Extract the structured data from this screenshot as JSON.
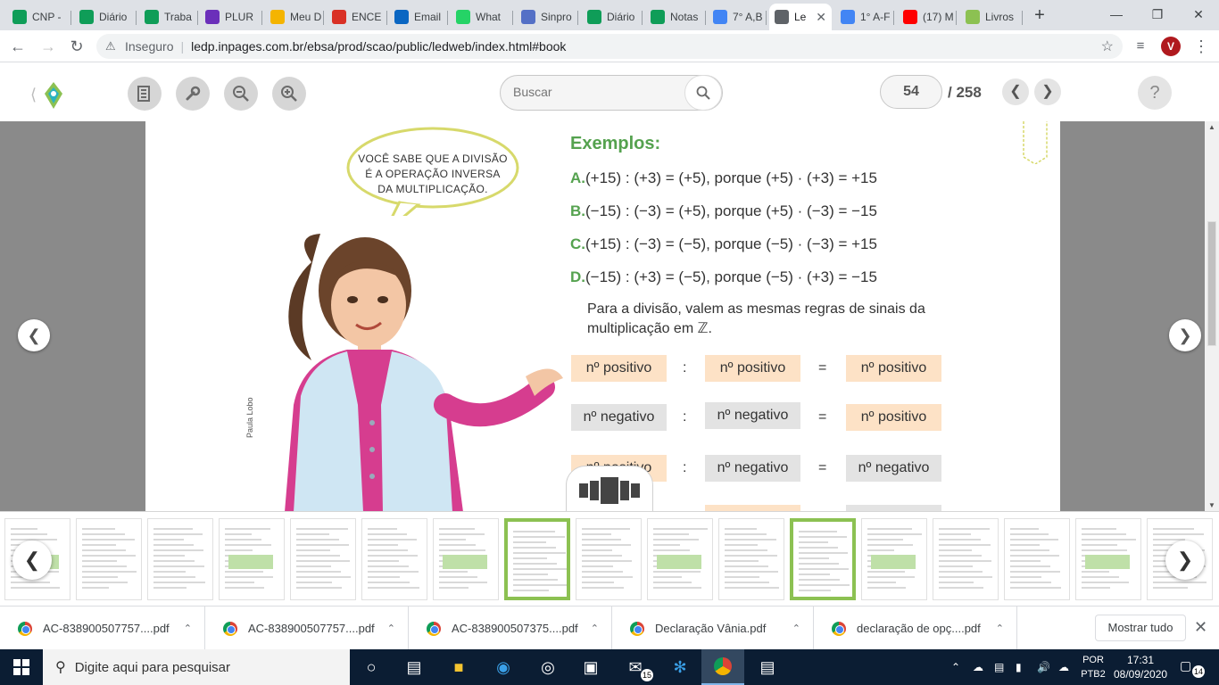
{
  "browser": {
    "tabs": [
      {
        "label": "CNP -",
        "color": "#0f9d58"
      },
      {
        "label": "Diário",
        "color": "#0f9d58"
      },
      {
        "label": "Traba",
        "color": "#0f9d58"
      },
      {
        "label": "PLUR",
        "color": "#6b2fba"
      },
      {
        "label": "Meu D",
        "color": "#f4b400"
      },
      {
        "label": "ENCE",
        "color": "#d93025"
      },
      {
        "label": "Email",
        "color": "#0a66c2"
      },
      {
        "label": "What",
        "color": "#25d366"
      },
      {
        "label": "Sinpro",
        "color": "#5470c6"
      },
      {
        "label": "Diário",
        "color": "#0f9d58"
      },
      {
        "label": "Notas",
        "color": "#0f9d58"
      },
      {
        "label": "7° A,B",
        "color": "#4285f4"
      },
      {
        "label": "Le",
        "color": "#5f6368"
      },
      {
        "label": "1° A-F",
        "color": "#4285f4"
      },
      {
        "label": "(17) M",
        "color": "#ff0000"
      },
      {
        "label": "Livros",
        "color": "#8cc152"
      }
    ],
    "security_label": "Inseguro",
    "url": "ledp.inpages.com.br/ebsa/prod/scao/public/ledweb/index.html#book",
    "profile_initial": "V"
  },
  "viewer": {
    "search_placeholder": "Buscar",
    "current_page": "54",
    "total_pages": "/ 258",
    "help_label": "?"
  },
  "page": {
    "bubble_text": "VOCÊ SABE QUE A DIVISÃO\nÉ A OPERAÇÃO INVERSA\nDA MULTIPLICAÇÃO.",
    "credit": "Paula Lobo",
    "examples_title": "Exemplos:",
    "examples": [
      {
        "letter": "A.",
        "text": "(+15) : (+3) = (+5), porque (+5) · (+3) = +15"
      },
      {
        "letter": "B.",
        "text": "(−15) : (−3) = (+5), porque (+5) · (−3) = −15"
      },
      {
        "letter": "C.",
        "text": "(+15) : (−3) = (−5), porque (−5) · (−3) = +15"
      },
      {
        "letter": "D.",
        "text": "(−15) : (+3) = (−5), porque (−5) · (+3) = −15"
      }
    ],
    "rule_text": "Para a divisão, valem as mesmas regras de sinais da multiplicação em ℤ.",
    "table": {
      "row1": [
        "nº positivo",
        ":",
        "nº positivo",
        "=",
        "nº positivo"
      ],
      "row2": [
        "nº negativo",
        ":",
        "nº negativo",
        "=",
        "nº positivo"
      ],
      "row3": [
        "nº positivo",
        ":",
        "nº negativo",
        "=",
        "nº negativo"
      ]
    },
    "colors": {
      "accent_green": "#55a24f",
      "positive_fill": "#fde2c6",
      "negative_fill": "#e3e3e3"
    }
  },
  "downloads": {
    "items": [
      "AC-838900507757....pdf",
      "AC-838900507757....pdf",
      "AC-838900507375....pdf",
      "Declaração Vânia.pdf",
      "declaração de opç....pdf"
    ],
    "show_all": "Mostrar tudo"
  },
  "taskbar": {
    "search_placeholder": "Digite aqui para pesquisar",
    "mail_badge": "15",
    "lang_top": "POR",
    "lang_bottom": "PTB2",
    "time": "17:31",
    "date": "08/09/2020",
    "notifications": "14"
  }
}
